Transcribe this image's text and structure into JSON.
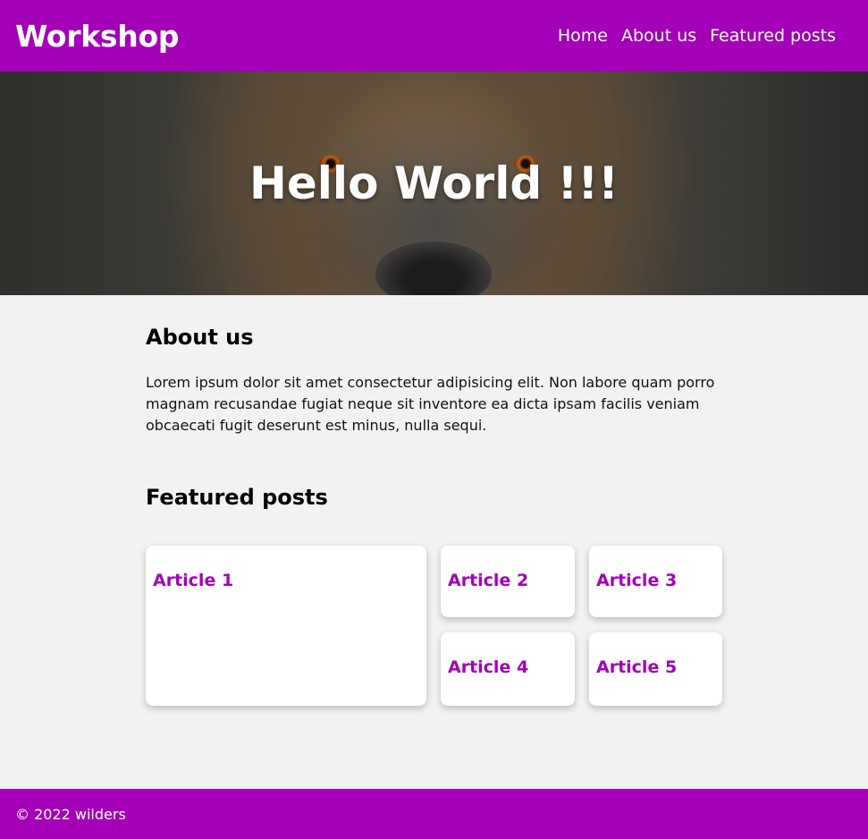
{
  "header": {
    "logo": "Workshop",
    "nav": [
      "Home",
      "About us",
      "Featured posts"
    ]
  },
  "hero": {
    "title": "Hello World !!!"
  },
  "about": {
    "title": "About us",
    "text": "Lorem ipsum dolor sit amet consectetur adipisicing elit. Non labore quam porro magnam recusandae fugiat neque sit inventore ea dicta ipsam facilis veniam obcaecati fugit deserunt est minus, nulla sequi."
  },
  "featured": {
    "title": "Featured posts",
    "articles": [
      "Article 1",
      "Article 2",
      "Article 3",
      "Article 4",
      "Article 5"
    ]
  },
  "footer": {
    "text": "© 2022 wilders"
  },
  "colors": {
    "brand": "#a300b8",
    "background": "#f2f2f2"
  }
}
